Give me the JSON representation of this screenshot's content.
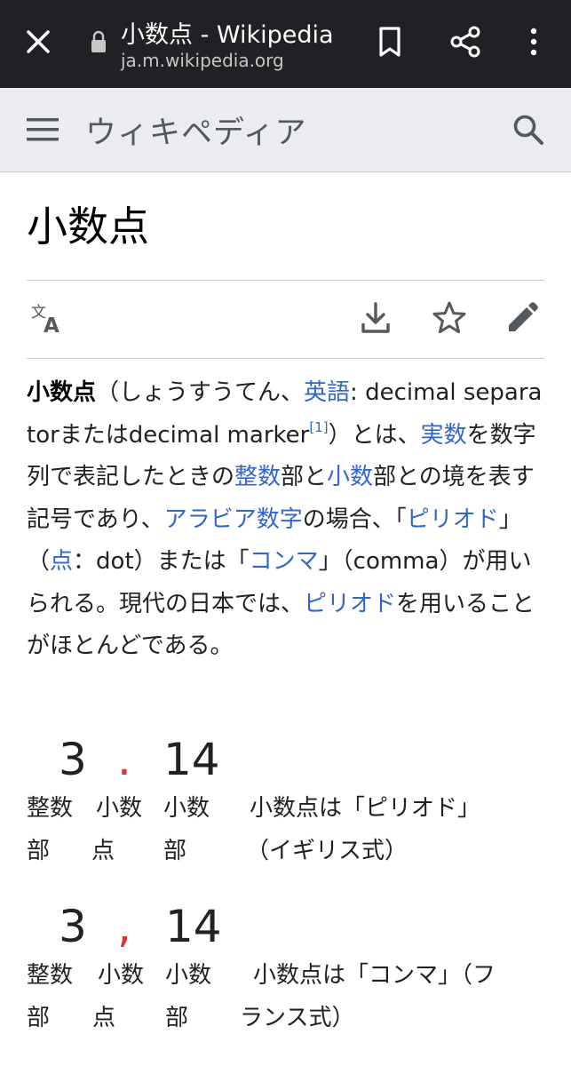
{
  "browser": {
    "title": "小数点 - Wikipedia",
    "url": "ja.m.wikipedia.org"
  },
  "header": {
    "wordmark": "ウィキペディア"
  },
  "article": {
    "title": "小数点",
    "lead": {
      "t_bold": "小数点",
      "t1": "（しょうすうてん、",
      "l_eigo": "英語",
      "t2": ": decimal separatorまたはdecimal marker",
      "ref": "[1]",
      "t3": "）とは、",
      "l_jissu": "実数",
      "t4": "を数字列で表記したときの",
      "l_seisu": "整数",
      "t5": "部と",
      "l_shosu": "小数",
      "t6": "部との境を表す記号であり、",
      "l_arabia": "アラビア数字",
      "t7": "の場合、「",
      "l_piriodo": "ピリオド",
      "t8": "」（",
      "l_ten": "点",
      "t9": "：dot）または「",
      "l_konma": "コンマ",
      "t10": "」（comma）が用いられる。現代の日本では、",
      "l_piriodo2": "ピリオド",
      "t11": "を用いることがほとんどである。"
    },
    "examples": [
      {
        "int": "3",
        "sep": ".",
        "frac": "14",
        "int_label_1": "整数",
        "int_label_2": "部",
        "sep_label_1": "小数",
        "sep_label_2": "点",
        "frac_label_1": "小数",
        "frac_label_2": "部",
        "desc_1": "小数点は「ピリオド」",
        "desc_2": "（イギリス式）"
      },
      {
        "int": "3",
        "sep": ",",
        "frac": "14",
        "int_label_1": "整数",
        "int_label_2": "部",
        "sep_label_1": "小数",
        "sep_label_2": "点",
        "frac_label_1": "小数",
        "frac_label_2": "部",
        "desc_1": "小数点は「コンマ」（フ",
        "desc_2": "ランス式）"
      }
    ]
  },
  "icons": {
    "close": "close-icon",
    "lock": "lock-icon",
    "bookmark": "bookmark-icon",
    "share": "share-icon",
    "more": "more-vert-icon",
    "menu": "menu-icon",
    "search": "search-icon",
    "language": "language-icon",
    "download": "download-icon",
    "watch": "star-icon",
    "edit": "edit-icon"
  },
  "colors": {
    "toolbar": "#202124",
    "header": "#eaecf0",
    "link": "#3366cc",
    "separator_red": "#dd3333"
  }
}
